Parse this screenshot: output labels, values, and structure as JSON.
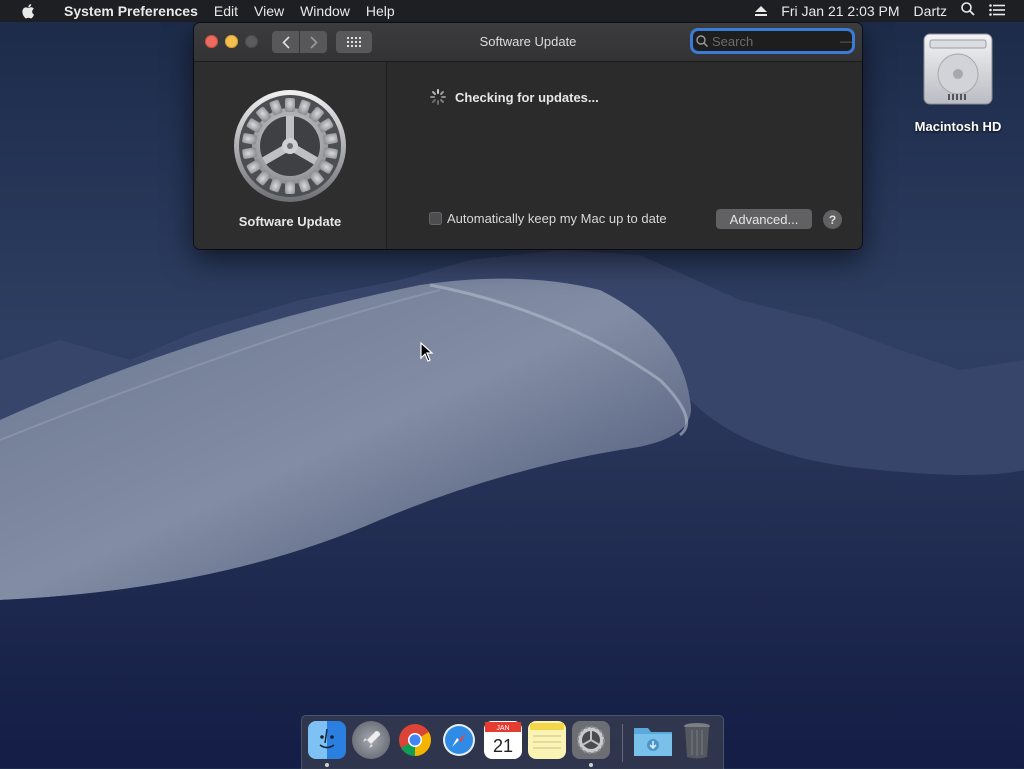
{
  "menubar": {
    "app_name": "System Preferences",
    "menus": [
      "Edit",
      "View",
      "Window",
      "Help"
    ],
    "datetime": "Fri Jan 21  2:03 PM",
    "user": "Dartz"
  },
  "window": {
    "title": "Software Update",
    "search_placeholder": "Search",
    "pane_label": "Software Update",
    "status_text": "Checking for updates...",
    "auto_update_label": "Automatically keep my Mac up to date",
    "auto_update_checked": false,
    "advanced_button": "Advanced...",
    "help_button": "?"
  },
  "desktop": {
    "disk_label": "Macintosh HD"
  },
  "dock": {
    "items": [
      "finder-icon",
      "launchpad-icon",
      "chrome-icon",
      "safari-icon",
      "calendar-icon",
      "notes-icon",
      "system-preferences-icon",
      "downloads-folder-icon",
      "trash-icon"
    ],
    "calendar_month": "JAN",
    "calendar_day": "21"
  },
  "colors": {
    "close": "#ed6a5e",
    "minimize": "#f5bf4f",
    "focus_ring": "#3b7bd6"
  }
}
